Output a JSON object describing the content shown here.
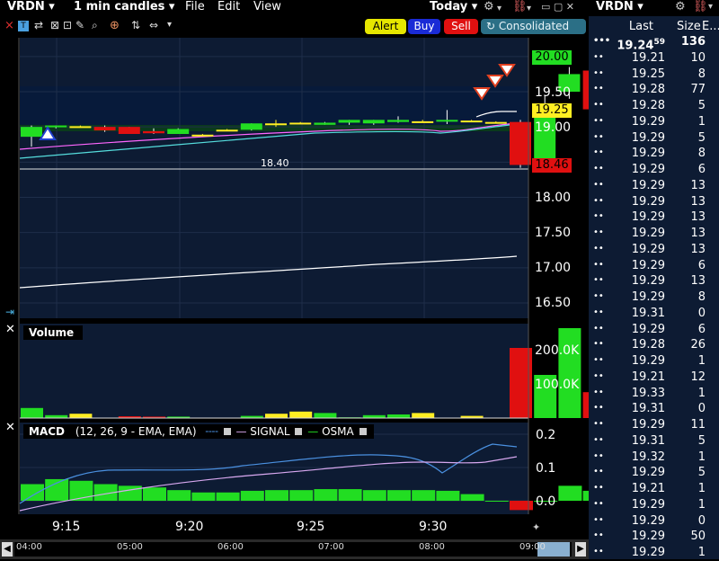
{
  "header": {
    "symbol": "VRDN",
    "interval": "1 min candles",
    "menus": [
      "File",
      "Edit",
      "View"
    ],
    "range": "Today",
    "close_glyph": "×",
    "tool_glyphs": [
      "T",
      "⇄",
      "⊠",
      "⊡",
      "✎",
      "⌕",
      "⊕",
      "⇅",
      "⇔"
    ]
  },
  "order_buttons": {
    "alert": "Alert",
    "buy": "Buy",
    "sell": "Sell",
    "route": "Consolidated"
  },
  "price_axis": [
    "19.50",
    "19.00",
    "18.00",
    "17.50",
    "17.00",
    "16.50"
  ],
  "price_markers": {
    "high": "20.00",
    "last": "19.25",
    "low": "18.46",
    "low_line": "18.40"
  },
  "volume_panel": {
    "title": "Volume",
    "axis": [
      "200.0K",
      "100.0K"
    ]
  },
  "macd_panel": {
    "title": "MACD",
    "params": "(12, 26, 9 - EMA, EMA)",
    "signal": "SIGNAL",
    "osma": "OSMA",
    "axis": [
      "0.2",
      "0.1",
      "0.0"
    ]
  },
  "time_axis": [
    "9:15",
    "9:20",
    "9:25",
    "9:30"
  ],
  "timeline": [
    "04:00",
    "05:00",
    "06:00",
    "07:00",
    "08:00",
    "09:00"
  ],
  "colors": {
    "background": "#0d1b33",
    "up": "#22dd22",
    "down": "#e01010",
    "doji": "#ffee22",
    "alert_btn": "#e6e600",
    "buy_btn": "#1a2bd6",
    "sell_btn": "#e01010",
    "route_btn": "#2b6f86"
  },
  "candles": [
    {
      "o": 18.86,
      "h": 19.02,
      "l": 18.72,
      "c": 19.0
    },
    {
      "o": 19.0,
      "h": 19.02,
      "l": 18.98,
      "c": 19.02
    },
    {
      "o": 19.01,
      "h": 19.02,
      "l": 18.99,
      "c": 19.0
    },
    {
      "o": 19.0,
      "h": 19.02,
      "l": 18.93,
      "c": 18.95
    },
    {
      "o": 19.0,
      "h": 19.0,
      "l": 18.9,
      "c": 18.9
    },
    {
      "o": 18.94,
      "h": 18.98,
      "l": 18.9,
      "c": 18.91
    },
    {
      "o": 18.9,
      "h": 18.98,
      "l": 18.9,
      "c": 18.97
    },
    {
      "o": 18.88,
      "h": 18.9,
      "l": 18.87,
      "c": 18.89
    },
    {
      "o": 18.96,
      "h": 18.97,
      "l": 18.95,
      "c": 18.96
    },
    {
      "o": 18.96,
      "h": 19.05,
      "l": 18.95,
      "c": 19.05
    },
    {
      "o": 19.05,
      "h": 19.1,
      "l": 19.0,
      "c": 19.05
    },
    {
      "o": 19.05,
      "h": 19.07,
      "l": 19.04,
      "c": 19.06
    },
    {
      "o": 19.03,
      "h": 19.07,
      "l": 19.03,
      "c": 19.06
    },
    {
      "o": 19.06,
      "h": 19.1,
      "l": 19.03,
      "c": 19.1
    },
    {
      "o": 19.05,
      "h": 19.1,
      "l": 19.03,
      "c": 19.1
    },
    {
      "o": 19.07,
      "h": 19.15,
      "l": 19.06,
      "c": 19.1
    },
    {
      "o": 19.08,
      "h": 19.1,
      "l": 19.06,
      "c": 19.07
    },
    {
      "o": 19.08,
      "h": 19.24,
      "l": 19.04,
      "c": 19.1
    },
    {
      "o": 19.08,
      "h": 19.1,
      "l": 19.07,
      "c": 19.09
    },
    {
      "o": 19.07,
      "h": 19.08,
      "l": 19.05,
      "c": 19.06
    },
    {
      "o": 19.07,
      "h": 19.1,
      "l": 18.42,
      "c": 18.46
    },
    {
      "o": 18.5,
      "h": 19.45,
      "l": 18.4,
      "c": 19.3
    },
    {
      "o": 19.5,
      "h": 19.85,
      "l": 19.4,
      "c": 19.75
    },
    {
      "o": 19.8,
      "h": 20.0,
      "l": 19.2,
      "c": 19.25
    }
  ],
  "volumes": [
    28,
    8,
    12,
    0,
    5,
    4,
    4,
    0,
    0,
    6,
    12,
    18,
    14,
    2,
    8,
    10,
    14,
    0,
    6,
    0,
    195,
    120,
    250,
    72
  ],
  "osma": [
    0.05,
    0.065,
    0.06,
    0.05,
    0.045,
    0.04,
    0.032,
    0.025,
    0.025,
    0.03,
    0.032,
    0.032,
    0.035,
    0.035,
    0.032,
    0.032,
    0.032,
    0.03,
    0.02,
    0.0,
    -0.028,
    0.0,
    0.045,
    0.03
  ],
  "trades": [
    {
      "last": "19.24",
      "sup": "59",
      "size": "136"
    },
    {
      "last": "19.21",
      "size": "10"
    },
    {
      "last": "19.25",
      "size": "8"
    },
    {
      "last": "19.28",
      "size": "77"
    },
    {
      "last": "19.28",
      "size": "5"
    },
    {
      "last": "19.29",
      "size": "1"
    },
    {
      "last": "19.29",
      "size": "5"
    },
    {
      "last": "19.29",
      "size": "8"
    },
    {
      "last": "19.29",
      "size": "6"
    },
    {
      "last": "19.29",
      "size": "13"
    },
    {
      "last": "19.29",
      "size": "13"
    },
    {
      "last": "19.29",
      "size": "13"
    },
    {
      "last": "19.29",
      "size": "13"
    },
    {
      "last": "19.29",
      "size": "13"
    },
    {
      "last": "19.29",
      "size": "6"
    },
    {
      "last": "19.29",
      "size": "13"
    },
    {
      "last": "19.29",
      "size": "8"
    },
    {
      "last": "19.31",
      "size": "0"
    },
    {
      "last": "19.29",
      "size": "6"
    },
    {
      "last": "19.28",
      "size": "26"
    },
    {
      "last": "19.29",
      "size": "1"
    },
    {
      "last": "19.21",
      "size": "12"
    },
    {
      "last": "19.33",
      "size": "1"
    },
    {
      "last": "19.31",
      "size": "0"
    },
    {
      "last": "19.29",
      "size": "11"
    },
    {
      "last": "19.31",
      "size": "5"
    },
    {
      "last": "19.32",
      "size": "1"
    },
    {
      "last": "19.29",
      "size": "5"
    },
    {
      "last": "19.21",
      "size": "1"
    },
    {
      "last": "19.29",
      "size": "1"
    },
    {
      "last": "19.29",
      "size": "0"
    },
    {
      "last": "19.29",
      "size": "50"
    },
    {
      "last": "19.29",
      "size": "1"
    }
  ],
  "right_panel": {
    "symbol": "VRDN",
    "col_last": "Last",
    "col_size": "Size",
    "col_exch": "E..."
  }
}
